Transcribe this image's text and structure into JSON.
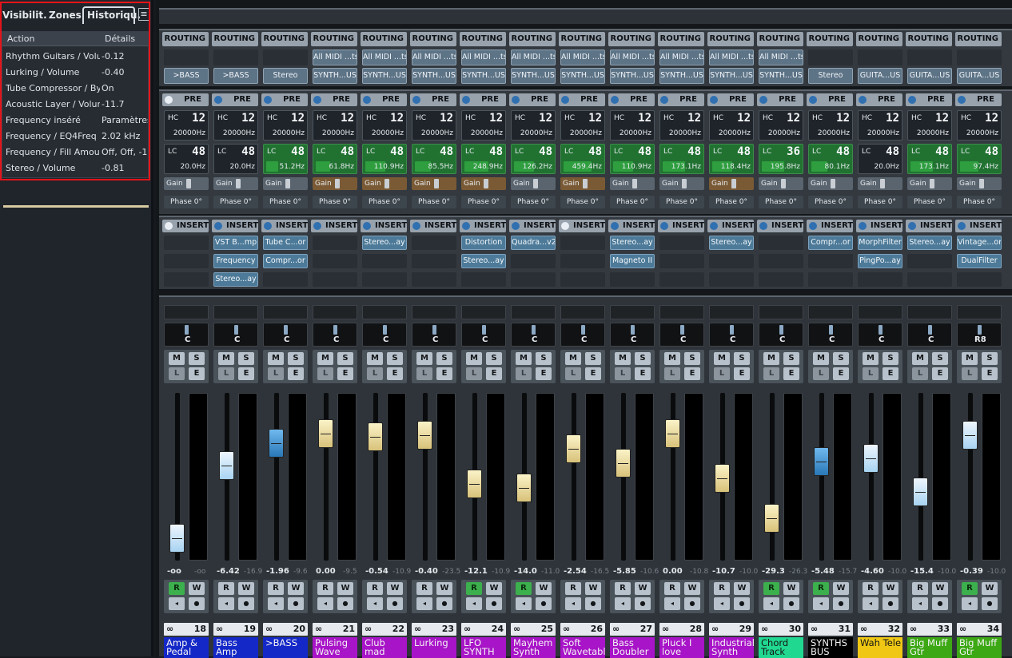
{
  "tabs": [
    "Visibilit.",
    "Zones",
    "Historiqu."
  ],
  "menu_icon": "menu-icon",
  "history": {
    "col_action": "Action",
    "col_details": "Détails",
    "rows": [
      {
        "action": "Rhythm Guitars / Volume",
        "details": "-0.12"
      },
      {
        "action": "Lurking / Volume",
        "details": "-0.40"
      },
      {
        "action": "Tube Compressor / Bypass",
        "details": "On"
      },
      {
        "action": "Acoustic Layer / Volume",
        "details": "-11.7"
      },
      {
        "action": "Frequency inséré",
        "details": "Paramètres"
      },
      {
        "action": "Frequency / EQ4Freq",
        "details": "2.02 kHz"
      },
      {
        "action": "Frequency / Fill Amount",
        "details": "Off, Off, -1"
      },
      {
        "action": "Stereo / Volume",
        "details": "-0.81"
      }
    ]
  },
  "labels": {
    "routing": "ROUTING",
    "pre": "PRE",
    "inserts": "INSERTS",
    "hc": "HC",
    "lc": "LC",
    "gain": "Gain",
    "mute": "M",
    "solo": "S",
    "listen": "L",
    "edit": "E",
    "read": "R",
    "write": "W"
  },
  "channels": [
    {
      "num": "18",
      "name": "Amp & Pedal",
      "color": "#1428c8",
      "in": "",
      "out": ">BASS",
      "hc": "12",
      "hcf": "20000Hz",
      "lc": "48",
      "lcf": "20.0Hz",
      "lcon": false,
      "lcbar": 0,
      "gainbr": false,
      "phase": "Phase 0°",
      "inserts": [
        "",
        "",
        ""
      ],
      "pan": "C",
      "vol": "-oo",
      "vol2": "-oo",
      "fader": 0.06,
      "cap": "white",
      "r": true,
      "pre_dot": "w",
      "ins_dot": "w"
    },
    {
      "num": "19",
      "name": "Bass Amp",
      "color": "#1428c8",
      "in": "",
      "out": ">BASS",
      "hc": "12",
      "hcf": "20000Hz",
      "lc": "48",
      "lcf": "20.0Hz",
      "lcon": false,
      "lcbar": 0,
      "gainbr": false,
      "phase": "Phase 0°",
      "inserts": [
        "VST B...mp",
        "Frequency",
        "Stereo...ay"
      ],
      "pan": "C",
      "vol": "-6.42",
      "vol2": "-16.9",
      "fader": 0.58,
      "cap": "white",
      "r": false,
      "pre_dot": "b",
      "ins_dot": "b"
    },
    {
      "num": "20",
      "name": ">BASS",
      "color": "#1428c8",
      "in": "",
      "out": "Stereo",
      "hc": "12",
      "hcf": "20000Hz",
      "lc": "48",
      "lcf": "51.2Hz",
      "lcon": true,
      "lcbar": 0.3,
      "gainbr": false,
      "phase": "Phase 0°",
      "inserts": [
        "Tube C...or",
        "Compr...or",
        ""
      ],
      "pan": "C",
      "vol": "-1.96",
      "vol2": "-9.6",
      "fader": 0.74,
      "cap": "blue",
      "r": false,
      "pre_dot": "b",
      "ins_dot": "b"
    },
    {
      "num": "21",
      "name": "Pulsing Wave",
      "color": "#a814c8",
      "in": "All MIDI ...ts",
      "out": "SYNTH...US",
      "hc": "12",
      "hcf": "20000Hz",
      "lc": "48",
      "lcf": "61.8Hz",
      "lcon": true,
      "lcbar": 0.35,
      "gainbr": true,
      "phase": "Phase 0°",
      "inserts": [
        "",
        "",
        ""
      ],
      "pan": "C",
      "vol": "0.00",
      "vol2": "-9.5",
      "fader": 0.81,
      "cap": "cream",
      "r": false,
      "pre_dot": "b",
      "ins_dot": "b"
    },
    {
      "num": "22",
      "name": "Club mad",
      "color": "#a814c8",
      "in": "All MIDI ...ts",
      "out": "SYNTH...US",
      "hc": "12",
      "hcf": "20000Hz",
      "lc": "48",
      "lcf": "110.9Hz",
      "lcon": true,
      "lcbar": 0.5,
      "gainbr": true,
      "phase": "Phase 0°",
      "inserts": [
        "Stereo...ay",
        "",
        ""
      ],
      "pan": "C",
      "vol": "-0.54",
      "vol2": "-10.9",
      "fader": 0.79,
      "cap": "cream",
      "r": false,
      "pre_dot": "b",
      "ins_dot": "b"
    },
    {
      "num": "23",
      "name": "Lurking",
      "color": "#a814c8",
      "in": "All MIDI ...ts",
      "out": "SYNTH...US",
      "hc": "12",
      "hcf": "20000Hz",
      "lc": "48",
      "lcf": "85.5Hz",
      "lcon": true,
      "lcbar": 0.4,
      "gainbr": true,
      "phase": "Phase 0°",
      "inserts": [
        "",
        "",
        ""
      ],
      "pan": "C",
      "vol": "-0.40",
      "vol2": "-23.5",
      "fader": 0.8,
      "cap": "cream",
      "r": false,
      "pre_dot": "b",
      "ins_dot": "b"
    },
    {
      "num": "24",
      "name": "LFO SYNTH",
      "color": "#a814c8",
      "in": "All MIDI ...ts",
      "out": "SYNTH...US",
      "hc": "12",
      "hcf": "20000Hz",
      "lc": "48",
      "lcf": "248.9Hz",
      "lcon": true,
      "lcbar": 0.6,
      "gainbr": true,
      "phase": "Phase 0°",
      "inserts": [
        "Distortion",
        "Stereo...ay",
        ""
      ],
      "pan": "C",
      "vol": "-12.1",
      "vol2": "-10.9",
      "fader": 0.45,
      "cap": "cream",
      "r": true,
      "pre_dot": "b",
      "ins_dot": "b"
    },
    {
      "num": "25",
      "name": "Mayhem Synth",
      "color": "#a814c8",
      "in": "All MIDI ...ts",
      "out": "SYNTH...US",
      "hc": "12",
      "hcf": "20000Hz",
      "lc": "48",
      "lcf": "126.2Hz",
      "lcon": true,
      "lcbar": 0.5,
      "gainbr": false,
      "phase": "Phase 0°",
      "inserts": [
        "Quadra...v2",
        "",
        ""
      ],
      "pan": "C",
      "vol": "-14.0",
      "vol2": "-11.0",
      "fader": 0.42,
      "cap": "cream",
      "r": true,
      "pre_dot": "b",
      "ins_dot": "b"
    },
    {
      "num": "26",
      "name": "Soft Wavetable",
      "color": "#a814c8",
      "in": "All MIDI ...ts",
      "out": "SYNTH...US",
      "hc": "12",
      "hcf": "20000Hz",
      "lc": "48",
      "lcf": "459.4Hz",
      "lcon": true,
      "lcbar": 0.7,
      "gainbr": true,
      "phase": "Phase 0°",
      "inserts": [
        "",
        "",
        ""
      ],
      "pan": "C",
      "vol": "-2.54",
      "vol2": "-16.5",
      "fader": 0.7,
      "cap": "cream",
      "r": false,
      "pre_dot": "b",
      "ins_dot": "w"
    },
    {
      "num": "27",
      "name": "Bass Doubler",
      "color": "#a814c8",
      "in": "All MIDI ...ts",
      "out": "SYNTH...US",
      "hc": "12",
      "hcf": "20000Hz",
      "lc": "48",
      "lcf": "110.9Hz",
      "lcon": true,
      "lcbar": 0.5,
      "gainbr": false,
      "phase": "Phase 0°",
      "inserts": [
        "Stereo...ay",
        "Magneto II",
        ""
      ],
      "pan": "C",
      "vol": "-5.85",
      "vol2": "-10.6",
      "fader": 0.6,
      "cap": "cream",
      "r": false,
      "pre_dot": "b",
      "ins_dot": "b"
    },
    {
      "num": "28",
      "name": "Pluck I love",
      "color": "#a814c8",
      "in": "All MIDI ...ts",
      "out": "SYNTH...US",
      "hc": "12",
      "hcf": "20000Hz",
      "lc": "48",
      "lcf": "173.1Hz",
      "lcon": true,
      "lcbar": 0.55,
      "gainbr": false,
      "phase": "Phase 0°",
      "inserts": [
        "",
        "",
        ""
      ],
      "pan": "C",
      "vol": "0.00",
      "vol2": "-10.8",
      "fader": 0.81,
      "cap": "cream",
      "r": false,
      "pre_dot": "b",
      "ins_dot": "b"
    },
    {
      "num": "29",
      "name": "Industrial Synth",
      "color": "#a814c8",
      "in": "All MIDI ...ts",
      "out": "SYNTH...US",
      "hc": "12",
      "hcf": "20000Hz",
      "lc": "48",
      "lcf": "118.4Hz",
      "lcon": true,
      "lcbar": 0.5,
      "gainbr": true,
      "phase": "Phase 0°",
      "inserts": [
        "Stereo...ay",
        "",
        ""
      ],
      "pan": "C",
      "vol": "-10.7",
      "vol2": "-10.0",
      "fader": 0.49,
      "cap": "cream",
      "r": false,
      "pre_dot": "b",
      "ins_dot": "b"
    },
    {
      "num": "30",
      "name": "Chord Track",
      "color": "#20d890",
      "in": "All MIDI ...ts",
      "out": "SYNTH...US",
      "hc": "12",
      "hcf": "20000Hz",
      "lc": "36",
      "lcf": "195.8Hz",
      "lcon": true,
      "lcbar": 0.55,
      "gainbr": false,
      "phase": "Phase 0°",
      "inserts": [
        "",
        "",
        ""
      ],
      "pan": "C",
      "vol": "-29.3",
      "vol2": "-26.3",
      "fader": 0.2,
      "cap": "cream",
      "r": true,
      "pre_dot": "b",
      "ins_dot": "b"
    },
    {
      "num": "31",
      "name": "SYNTHS BUS",
      "color": "#000000",
      "in": "",
      "out": "Stereo",
      "hc": "12",
      "hcf": "20000Hz",
      "lc": "48",
      "lcf": "80.1Hz",
      "lcon": true,
      "lcbar": 0.4,
      "gainbr": false,
      "phase": "Phase 0°",
      "inserts": [
        "Compr...or",
        "",
        ""
      ],
      "pan": "C",
      "vol": "-5.48",
      "vol2": "-15.7",
      "fader": 0.61,
      "cap": "blue",
      "r": true,
      "pre_dot": "b",
      "ins_dot": "b"
    },
    {
      "num": "32",
      "name": "Wah Tele",
      "color": "#f0c814",
      "in": "",
      "out": "GUITA...US",
      "hc": "12",
      "hcf": "20000Hz",
      "lc": "48",
      "lcf": "20.0Hz",
      "lcon": false,
      "lcbar": 0,
      "gainbr": false,
      "phase": "Phase 0°",
      "inserts": [
        "MorphFilter",
        "PingPo...ay",
        ""
      ],
      "pan": "C",
      "vol": "-4.60",
      "vol2": "-10.0",
      "fader": 0.63,
      "cap": "white",
      "r": false,
      "pre_dot": "b",
      "ins_dot": "b"
    },
    {
      "num": "33",
      "name": "Big Muff Gtr",
      "color": "#3ca814",
      "in": "",
      "out": "GUITA...US",
      "hc": "12",
      "hcf": "20000Hz",
      "lc": "48",
      "lcf": "173.1Hz",
      "lcon": true,
      "lcbar": 0.55,
      "gainbr": false,
      "phase": "Phase 0°",
      "inserts": [
        "Stereo...ay",
        "",
        ""
      ],
      "pan": "C",
      "vol": "-15.4",
      "vol2": "-10.0",
      "fader": 0.39,
      "cap": "white",
      "r": false,
      "pre_dot": "b",
      "ins_dot": "b"
    },
    {
      "num": "34",
      "name": "Big Muff Gtr",
      "color": "#3ca814",
      "in": "",
      "out": "GUITA...US",
      "hc": "12",
      "hcf": "20000Hz",
      "lc": "48",
      "lcf": "97.4Hz",
      "lcon": true,
      "lcbar": 0.45,
      "gainbr": false,
      "phase": "Phase 0°",
      "inserts": [
        "Vintage...or",
        "DualFilter",
        ""
      ],
      "pan": "R8",
      "vol": "-0.39",
      "vol2": "-10.0",
      "fader": 0.8,
      "cap": "white",
      "r": true,
      "pre_dot": "b",
      "ins_dot": "b"
    }
  ]
}
